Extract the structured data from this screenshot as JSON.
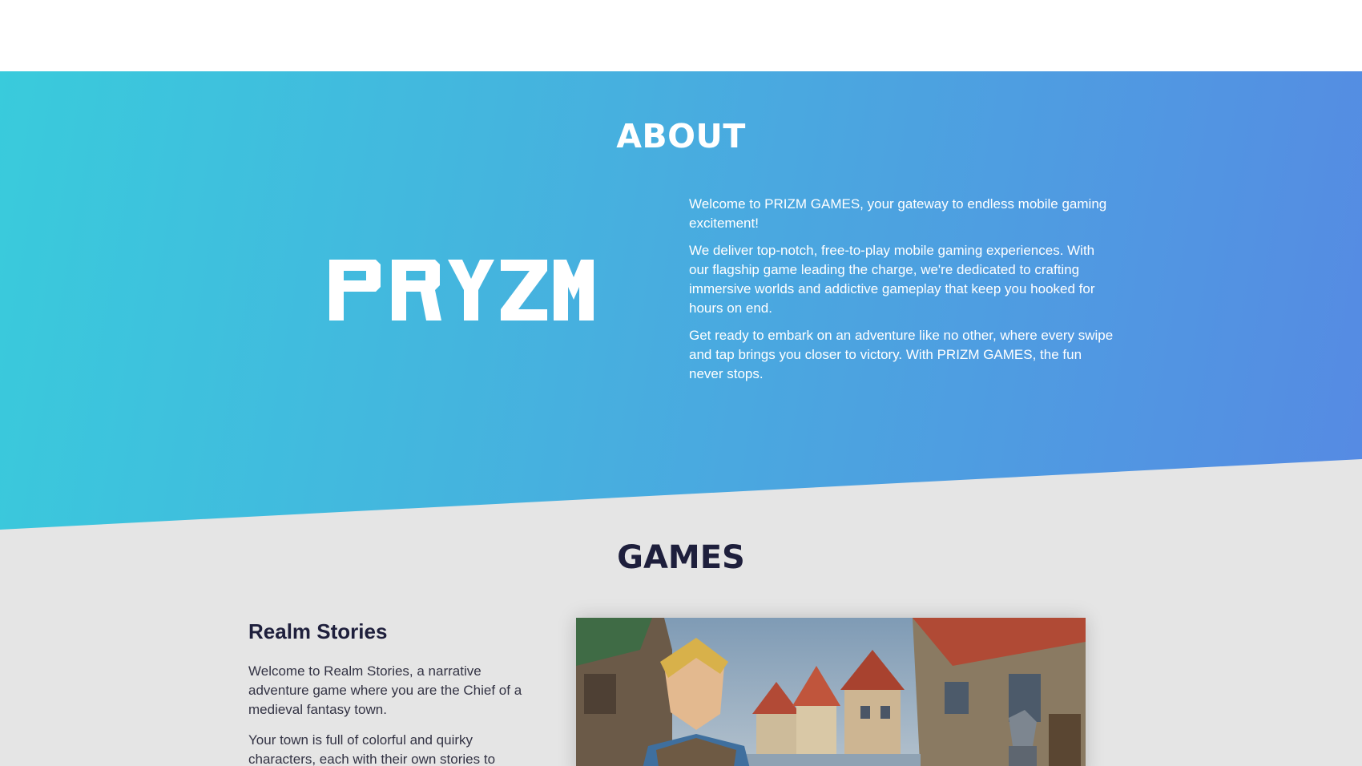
{
  "about": {
    "title": "ABOUT",
    "logo_text": "PRYZM",
    "paragraphs": [
      "Welcome to PRIZM GAMES, your gateway to endless mobile gaming excitement!",
      "We deliver top-notch, free-to-play mobile gaming experiences. With our flagship game leading the charge, we're dedicated to crafting immersive worlds and addictive gameplay that keep you hooked for hours on end.",
      "Get ready to embark on an adventure like no other, where every swipe and tap brings you closer to victory. With PRIZM GAMES, the fun never stops."
    ]
  },
  "games": {
    "title": "GAMES",
    "items": [
      {
        "name": "Realm Stories",
        "paragraphs": [
          "Welcome to Realm Stories, a narrative adventure game where you are the Chief of a medieval fantasy town.",
          "Your town is full of colorful and quirky characters, each with their own stories to"
        ],
        "image_icon": "medieval-town-screenshot"
      }
    ]
  },
  "colors": {
    "gradient_start": "#39cbdc",
    "gradient_end": "#568ae3",
    "heading_dark": "#1e1f3c",
    "background": "#e5e5e5"
  }
}
